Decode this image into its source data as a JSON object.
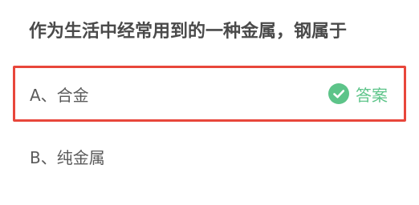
{
  "question": {
    "text": "作为生活中经常用到的一种金属，钢属于"
  },
  "options": [
    {
      "label": "A、合金",
      "is_answer": true,
      "answer_tag": "答案"
    },
    {
      "label": "B、纯金属",
      "is_answer": false
    }
  ],
  "colors": {
    "selected_border": "#e8463b",
    "answer_green": "#5dc489",
    "text": "#5a5a5a"
  }
}
